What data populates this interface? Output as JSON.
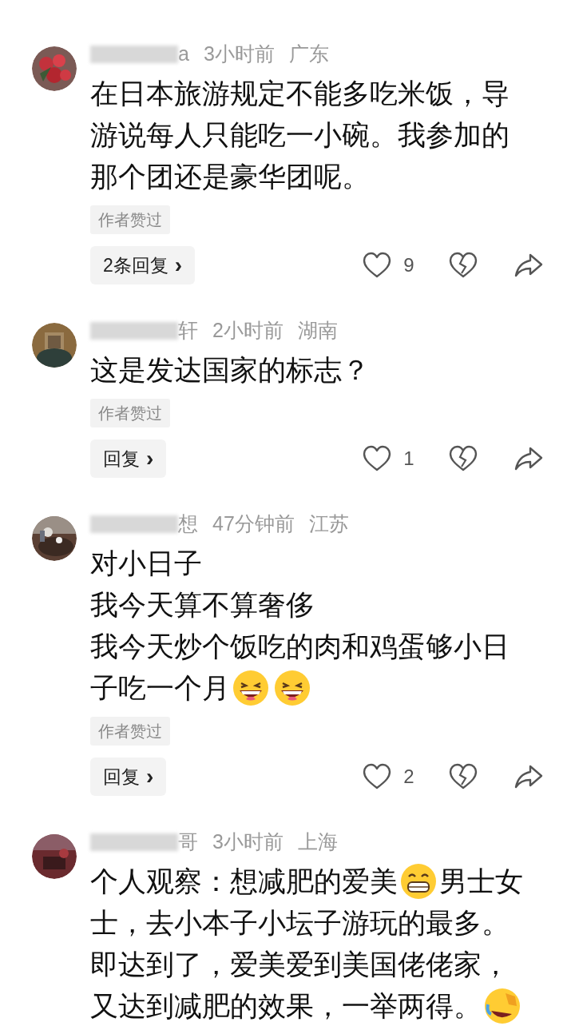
{
  "comments": [
    {
      "user_visible": "a",
      "time": "3小时前",
      "location": "广东",
      "lines": [
        [
          {
            "kind": "text",
            "text": "在日本旅游规定不能多吃米饭，导"
          }
        ],
        [
          {
            "kind": "text",
            "text": "游说每人只能吃一小碗。我参加的"
          }
        ],
        [
          {
            "kind": "text",
            "text": "那个团还是豪华团呢。"
          }
        ]
      ],
      "tag": "作者赞过",
      "reply": "2条回复",
      "reply_caret": "›",
      "likes": "9"
    },
    {
      "user_visible": "轩",
      "time": "2小时前",
      "location": "湖南",
      "lines": [
        [
          {
            "kind": "text",
            "text": "这是发达国家的标志？"
          }
        ]
      ],
      "tag": "作者赞过",
      "reply": "回复",
      "reply_caret": "›",
      "likes": "1"
    },
    {
      "user_visible": "想",
      "time": "47分钟前",
      "location": "江苏",
      "lines": [
        [
          {
            "kind": "text",
            "text": "对小日子"
          }
        ],
        [
          {
            "kind": "text",
            "text": "我今天算不算奢侈"
          }
        ],
        [
          {
            "kind": "text",
            "text": "我今天炒个饭吃的肉和鸡蛋够小日"
          }
        ],
        [
          {
            "kind": "text",
            "text": "子吃一个月"
          },
          {
            "kind": "laughing"
          },
          {
            "kind": "laughing"
          }
        ]
      ],
      "tag": "作者赞过",
      "reply": "回复",
      "reply_caret": "›",
      "likes": "2"
    },
    {
      "user_visible": "哥",
      "time": "3小时前",
      "location": "上海",
      "lines": [
        [
          {
            "kind": "text",
            "text": "个人观察：想减肥的爱美"
          },
          {
            "kind": "grinning"
          },
          {
            "kind": "text",
            "text": "男士女"
          }
        ],
        [
          {
            "kind": "text",
            "text": "士，去小本子小坛子游玩的最多。"
          }
        ],
        [
          {
            "kind": "text",
            "text": "即达到了，爱美爱到美国佬佬家，"
          }
        ],
        [
          {
            "kind": "text",
            "text": "又达到减肥的效果，一举两得。"
          },
          {
            "kind": "rolling"
          }
        ]
      ]
    }
  ]
}
